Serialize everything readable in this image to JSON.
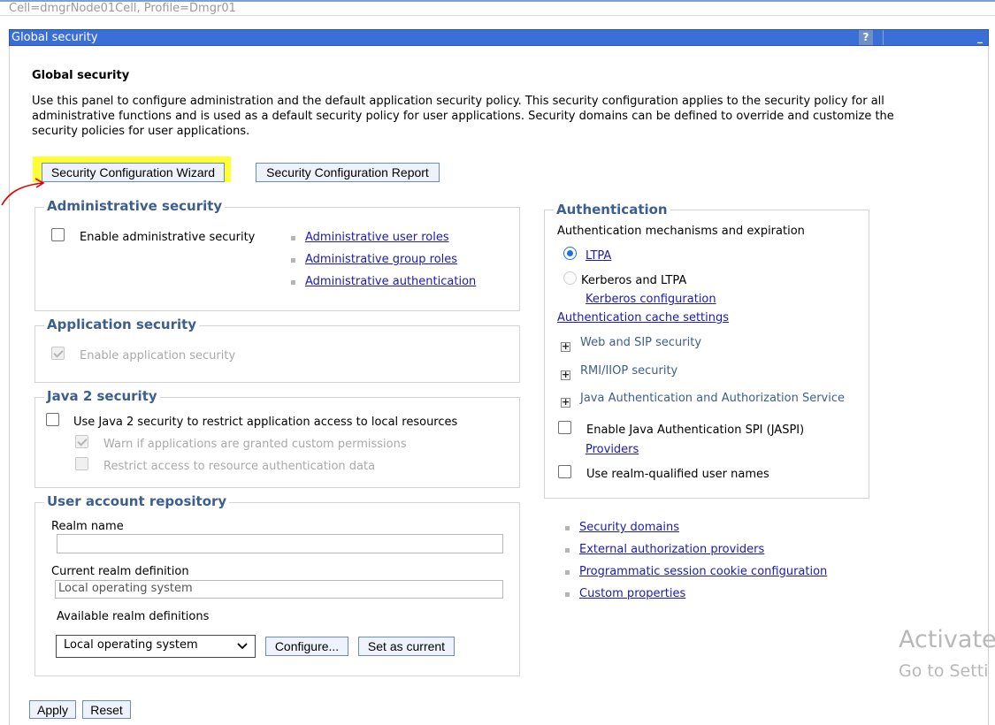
{
  "breadcrumb": "Cell=dmgrNode01Cell, Profile=Dmgr01",
  "titlebar": {
    "title": "Global security",
    "help": "?",
    "minimize": "_"
  },
  "page_title": "Global security",
  "description": "Use this panel to configure administration and the default application security policy. This security configuration applies to the security policy for all administrative functions and is used as a default security policy for user applications. Security domains can be defined to override and customize the security policies for user applications.",
  "buttons": {
    "wizard": "Security Configuration Wizard",
    "report": "Security Configuration Report"
  },
  "admin_security": {
    "title": "Administrative security",
    "enable_label": "Enable administrative security",
    "enabled": false,
    "links": [
      "Administrative user roles",
      "Administrative group roles",
      "Administrative authentication"
    ]
  },
  "app_security": {
    "title": "Application security",
    "enable_label": "Enable application security",
    "enabled": true
  },
  "java2_security": {
    "title": "Java 2 security",
    "use_label": "Use Java 2 security to restrict application access to local resources",
    "warn_label": "Warn if applications are granted custom permissions",
    "restrict_label": "Restrict access to resource authentication data"
  },
  "user_repo": {
    "title": "User account repository",
    "realm_name_label": "Realm name",
    "realm_name_value": "",
    "current_def_label": "Current realm definition",
    "current_def_value": "Local operating system",
    "available_label": "Available realm definitions",
    "available_selected": "Local operating system",
    "configure_btn": "Configure...",
    "set_current_btn": "Set as current"
  },
  "authentication": {
    "title": "Authentication",
    "mech_label": "Authentication mechanisms and expiration",
    "ltpa": "LTPA",
    "kerberos": "Kerberos and LTPA",
    "kerberos_config": "Kerberos configuration",
    "cache_settings": "Authentication cache settings",
    "expandables": [
      "Web and SIP security",
      "RMI/IIOP security",
      "Java Authentication and Authorization Service"
    ],
    "jaspi_label": "Enable Java Authentication SPI (JASPI)",
    "providers": "Providers",
    "realm_qualified": "Use realm-qualified user names"
  },
  "other_links": [
    "Security domains",
    "External authorization providers",
    "Programmatic session cookie configuration",
    "Custom properties"
  ],
  "footer": {
    "apply": "Apply",
    "reset": "Reset"
  },
  "watermark": {
    "line1": "Activate",
    "line2": "Go to Setti"
  },
  "colors": {
    "titlebar": "#3a6fd8",
    "section_title": "#3c5f8e",
    "link": "#1a1ab8",
    "highlight": "#ffff33",
    "annotation_arrow": "#e00000"
  }
}
